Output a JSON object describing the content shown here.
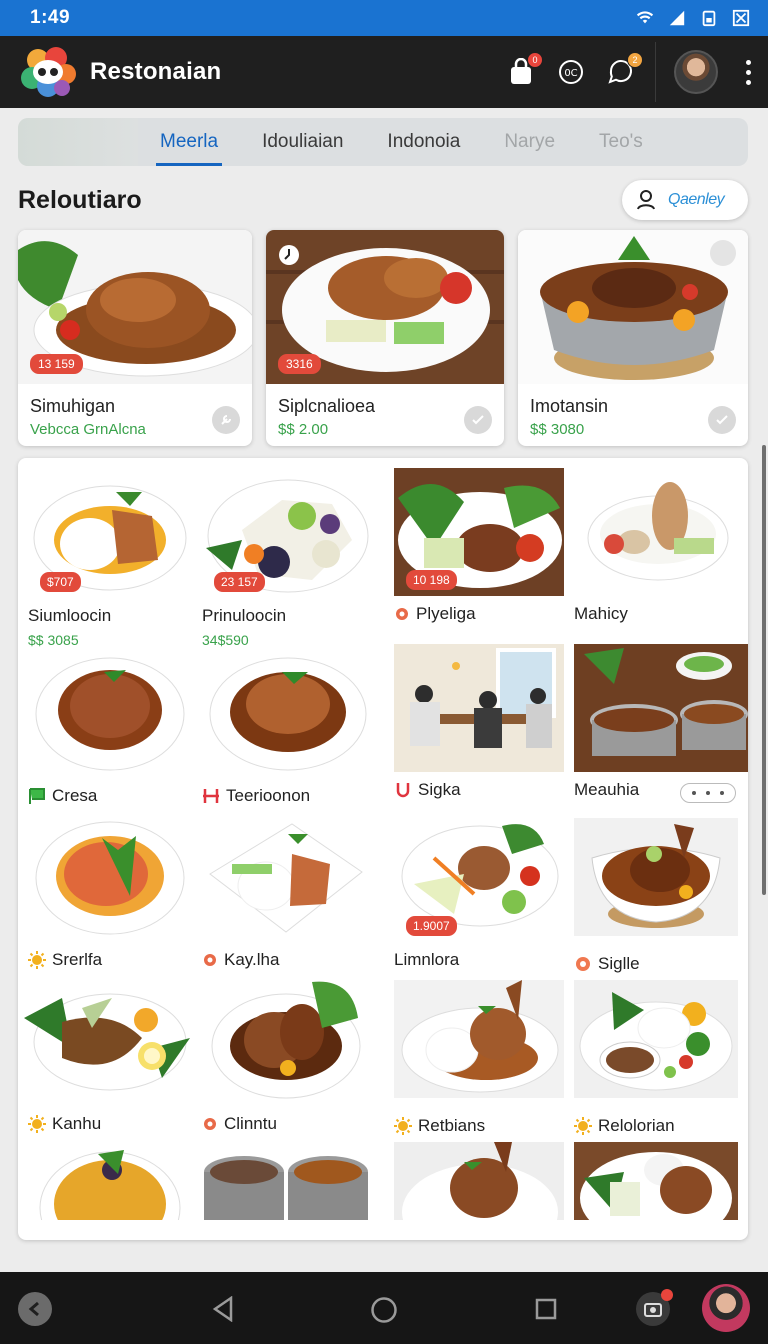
{
  "status_bar": {
    "time": "1:49"
  },
  "app": {
    "title": "Restonaian",
    "cart_badge": "0",
    "notification_badge": "2"
  },
  "tabs": [
    {
      "label": "Meerla",
      "state": "active"
    },
    {
      "label": "Idouliaian",
      "state": "normal"
    },
    {
      "label": "Indonoia",
      "state": "normal"
    },
    {
      "label": "Narye",
      "state": "dim"
    },
    {
      "label": "Teo's",
      "state": "dim"
    }
  ],
  "section": {
    "title": "Reloutiaro",
    "queue_label": "Qaenley"
  },
  "featured": [
    {
      "name": "Simuhigan",
      "sub": "Vebcca GrnAlcna",
      "price_tag": "13 159"
    },
    {
      "name": "Siplcnalioea",
      "sub": "$$ 2.00",
      "price_tag": "3316"
    },
    {
      "name": "Imotansin",
      "sub": "$$ 3080",
      "price_tag": ""
    }
  ],
  "grid": [
    {
      "label": "Siumloocin",
      "price": "$$ 3085",
      "tag": "$707",
      "icon": ""
    },
    {
      "label": "Prinuloocin",
      "price": "34$590",
      "tag": "23 157",
      "icon": ""
    },
    {
      "label": "Plyeliga",
      "price": "",
      "tag": "10 198",
      "icon": "gear-icon"
    },
    {
      "label": "Mahicy",
      "price": "",
      "tag": "",
      "icon": ""
    },
    {
      "label": "Cresa",
      "price": "",
      "tag": "",
      "icon": "flag-icon"
    },
    {
      "label": "Teerioonon",
      "price": "",
      "tag": "",
      "icon": "h-icon"
    },
    {
      "label": "Sigka",
      "price": "",
      "tag": "",
      "icon": "bracket-icon"
    },
    {
      "label": "Meauhia",
      "price": "",
      "tag": "",
      "icon": ""
    },
    {
      "label": "Srerlfa",
      "price": "",
      "tag": "",
      "icon": "sun-icon"
    },
    {
      "label": "Kay.lha",
      "price": "",
      "tag": "",
      "icon": "gear-icon"
    },
    {
      "label": "Limnlora",
      "price": "",
      "tag": "1.9007",
      "icon": ""
    },
    {
      "label": "Siglle",
      "price": "",
      "tag": "",
      "icon": "dot-icon"
    },
    {
      "label": "Kanhu",
      "price": "",
      "tag": "",
      "icon": "sun-icon"
    },
    {
      "label": "Clinntu",
      "price": "",
      "tag": "",
      "icon": "gear-icon"
    },
    {
      "label": "Retbians",
      "price": "",
      "tag": "",
      "icon": "sun-icon"
    },
    {
      "label": "Relolorian",
      "price": "",
      "tag": "",
      "icon": "sun-icon"
    }
  ],
  "colors": {
    "accent": "#1565c0",
    "status_bar": "#1a73d1",
    "price_green": "#39a24b",
    "tag_red": "#e24a3b"
  }
}
